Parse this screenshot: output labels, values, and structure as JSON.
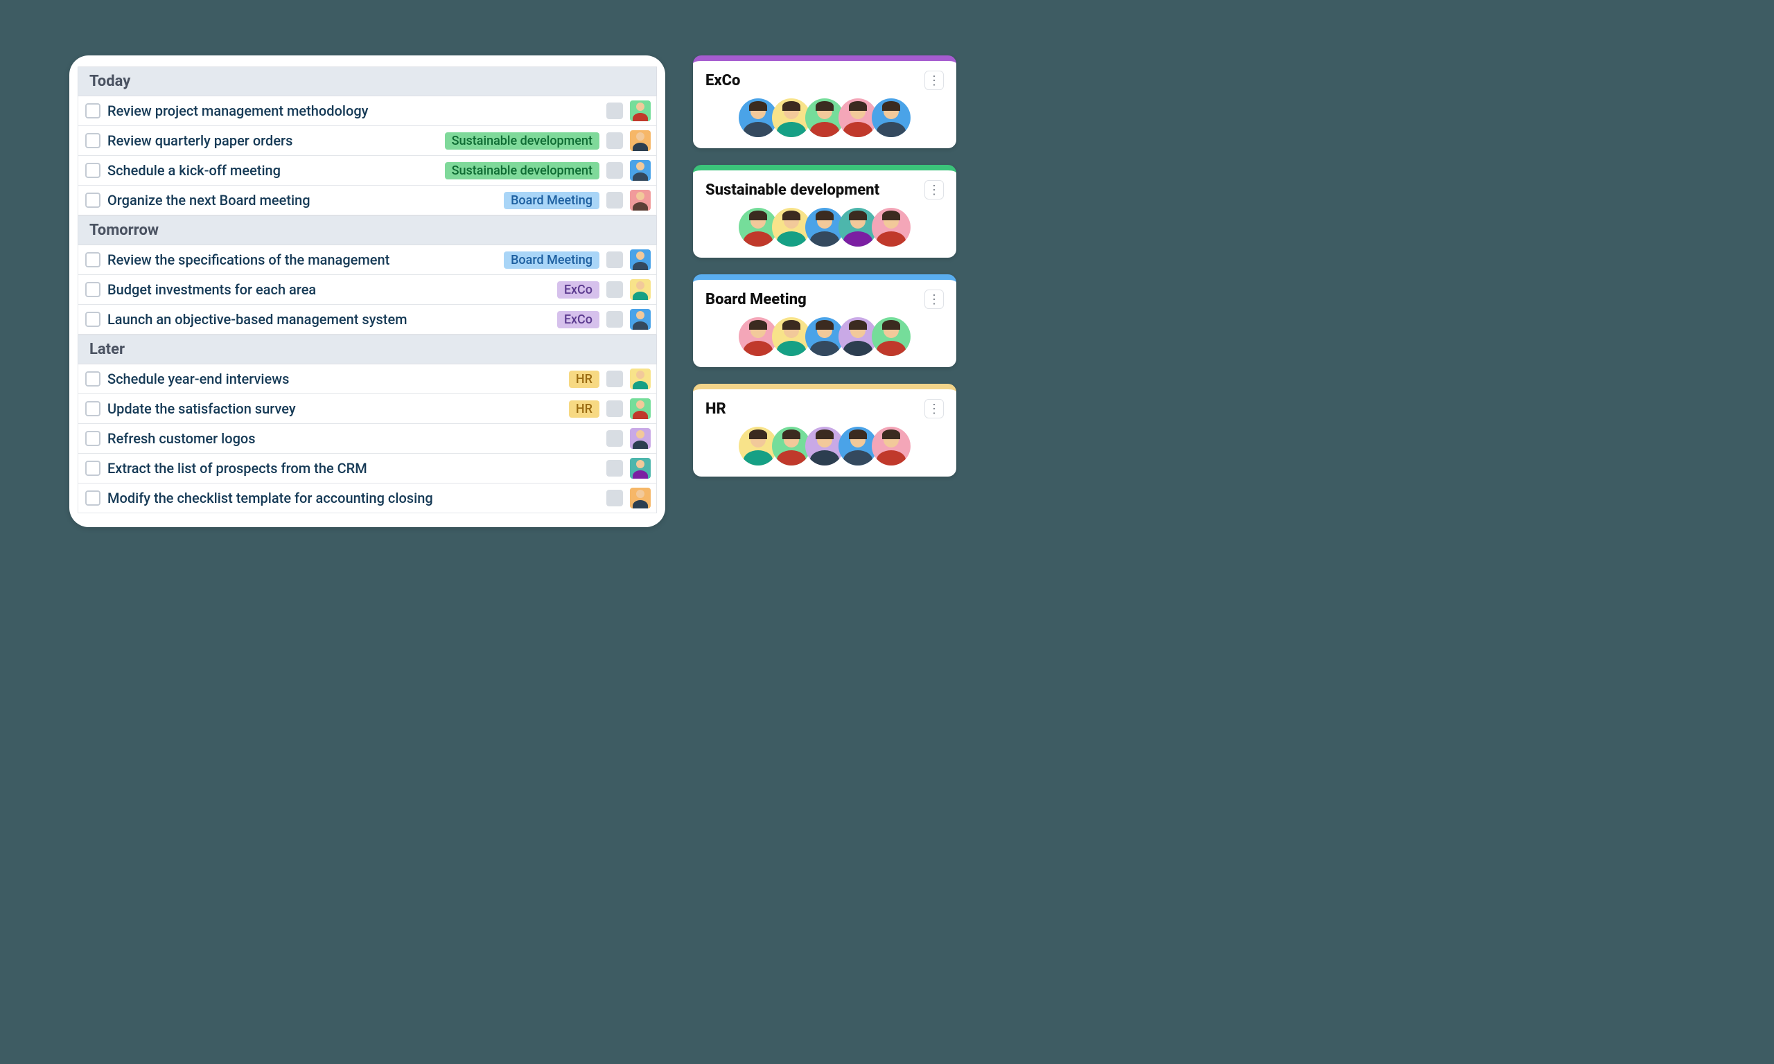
{
  "tag_styles": {
    "Sustainable development": {
      "bg": "#7fd99a",
      "fg": "#0e6b33"
    },
    "Board Meeting": {
      "bg": "#a9d5f7",
      "fg": "#1d5fa0"
    },
    "ExCo": {
      "bg": "#d6c1ec",
      "fg": "#5c3b90"
    },
    "HR": {
      "bg": "#f7d983",
      "fg": "#9a6b12"
    }
  },
  "avatar_palette": {
    "green": {
      "bg": "#75dd9a",
      "shirt": "#c0392b"
    },
    "orange": {
      "bg": "#f6b768",
      "shirt": "#2c3e50"
    },
    "blue": {
      "bg": "#4aa3e8",
      "shirt": "#34495e"
    },
    "red": {
      "bg": "#f19b9b",
      "shirt": "#5d4037"
    },
    "yellow": {
      "bg": "#f8e38a",
      "shirt": "#16a085"
    },
    "purple": {
      "bg": "#c9a9e6",
      "shirt": "#2c3e50"
    },
    "teal": {
      "bg": "#4db6ac",
      "shirt": "#7b1fa2"
    },
    "pink": {
      "bg": "#f4a6b8",
      "shirt": "#c0392b"
    }
  },
  "sections": [
    {
      "title": "Today",
      "tasks": [
        {
          "title": "Review project management methodology",
          "tag": null,
          "avatar": "green"
        },
        {
          "title": "Review quarterly paper orders",
          "tag": "Sustainable development",
          "avatar": "orange"
        },
        {
          "title": "Schedule a kick-off meeting",
          "tag": "Sustainable development",
          "avatar": "blue"
        },
        {
          "title": "Organize the next Board meeting",
          "tag": "Board Meeting",
          "avatar": "red"
        }
      ]
    },
    {
      "title": "Tomorrow",
      "tasks": [
        {
          "title": "Review the specifications of the management",
          "tag": "Board Meeting",
          "avatar": "blue"
        },
        {
          "title": "Budget investments for each area",
          "tag": "ExCo",
          "avatar": "yellow"
        },
        {
          "title": "Launch an objective-based management system",
          "tag": "ExCo",
          "avatar": "blue"
        }
      ]
    },
    {
      "title": "Later",
      "tasks": [
        {
          "title": "Schedule year-end interviews",
          "tag": "HR",
          "avatar": "yellow"
        },
        {
          "title": "Update the satisfaction survey",
          "tag": "HR",
          "avatar": "green"
        },
        {
          "title": "Refresh customer logos",
          "tag": null,
          "avatar": "purple"
        },
        {
          "title": "Extract the list of prospects from the CRM",
          "tag": null,
          "avatar": "teal"
        },
        {
          "title": "Modify the checklist template for accounting closing",
          "tag": null,
          "avatar": "orange"
        }
      ]
    }
  ],
  "subjects": [
    {
      "title": "ExCo",
      "stripe": "#a65cd0",
      "members": [
        "blue",
        "yellow",
        "green",
        "pink",
        "blue"
      ]
    },
    {
      "title": "Sustainable development",
      "stripe": "#3bc47a",
      "members": [
        "green",
        "yellow",
        "blue",
        "teal",
        "pink"
      ]
    },
    {
      "title": "Board Meeting",
      "stripe": "#5aaef0",
      "members": [
        "pink",
        "yellow",
        "blue",
        "purple",
        "green"
      ]
    },
    {
      "title": "HR",
      "stripe": "#f2d48a",
      "members": [
        "yellow",
        "green",
        "purple",
        "blue",
        "pink"
      ]
    }
  ]
}
